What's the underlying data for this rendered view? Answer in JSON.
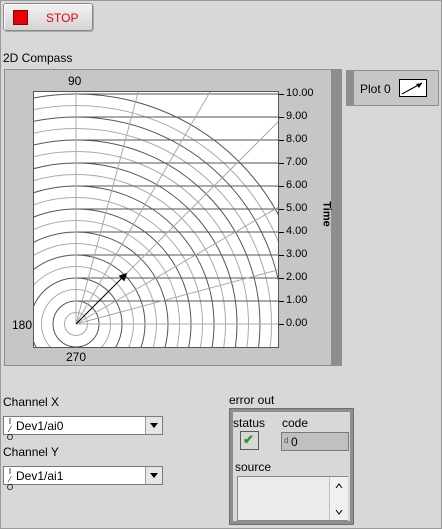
{
  "stop": {
    "label": "STOP",
    "led_color": "#e8000a"
  },
  "compass": {
    "title": "2D Compass",
    "angle_labels": {
      "top": "90",
      "left": "180",
      "bottom": "270"
    },
    "axis_title": "Time",
    "time_ticks": [
      "10.00",
      "9.00",
      "8.00",
      "7.00",
      "6.00",
      "5.00",
      "4.00",
      "3.00",
      "2.00",
      "1.00",
      "0.00"
    ],
    "legend_label": "Plot 0"
  },
  "chart_data": {
    "type": "scatter",
    "title": "2D Compass",
    "ylabel": "Time",
    "radial_range": [
      0,
      10
    ],
    "angle_labels": [
      "90",
      "180",
      "270"
    ],
    "series": [
      {
        "name": "Plot 0",
        "vectors": [
          {
            "angle_deg": 45,
            "magnitude": 3.1
          }
        ]
      }
    ]
  },
  "channel_x": {
    "label": "Channel X",
    "value": "Dev1/ai0",
    "io_icon": "I/O"
  },
  "channel_y": {
    "label": "Channel Y",
    "value": "Dev1/ai1",
    "io_icon": "I/O"
  },
  "error_out": {
    "title": "error out",
    "status_label": "status",
    "code_label": "code",
    "code_prefix": "d",
    "code_value": "0",
    "source_label": "source",
    "status_check": "✔"
  }
}
